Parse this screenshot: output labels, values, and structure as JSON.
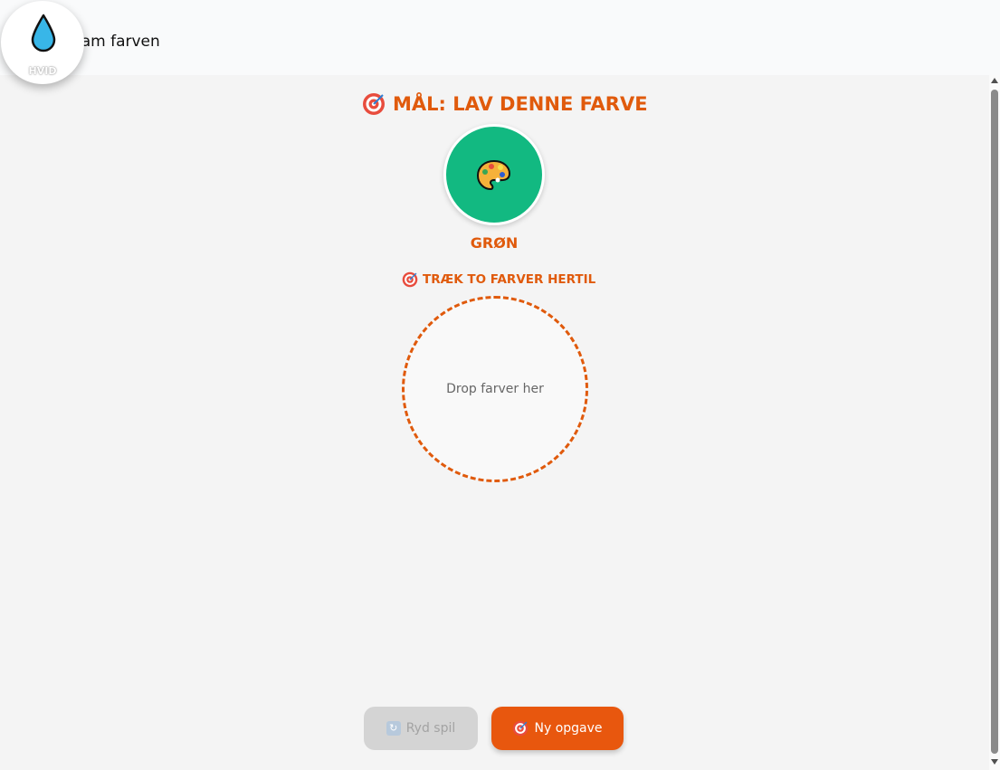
{
  "header": {
    "title": "lam farven"
  },
  "selected_color": {
    "label": "HVID",
    "icon": "water-drop-icon",
    "drop_color": "#38b6e8"
  },
  "goal": {
    "heading": "MÅL: LAV DENNE FARVE",
    "color_name": "GRØN",
    "color_hex": "#12b981",
    "icon": "palette-icon"
  },
  "mixer": {
    "hint": "TRÆK TO FARVER HERTIL",
    "drop_placeholder": "Drop farver her"
  },
  "actions": {
    "reset_label": "Ryd spil",
    "new_task_label": "Ny opgave"
  },
  "theme": {
    "accent": "#e05a0c"
  }
}
